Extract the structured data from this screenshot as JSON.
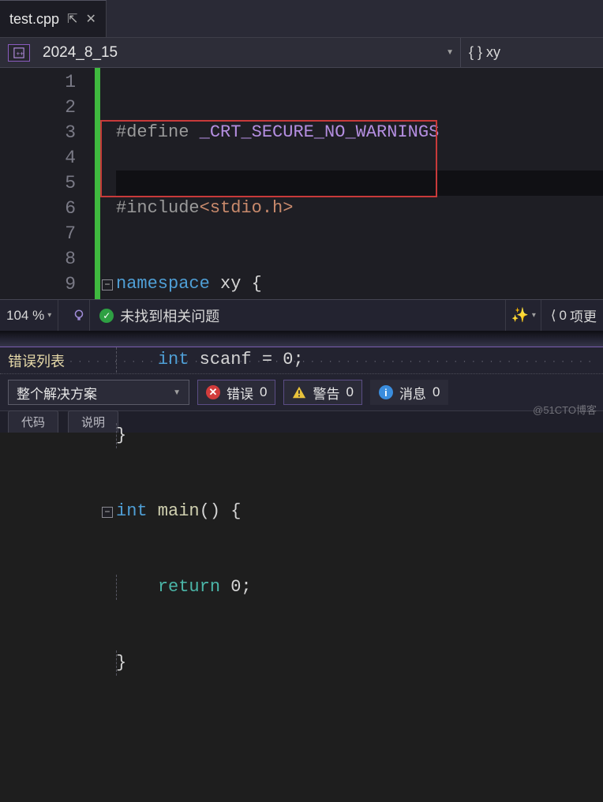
{
  "tab": {
    "filename": "test.cpp"
  },
  "dropdown": {
    "scope": "2024_8_15",
    "member": "{ } xy"
  },
  "code": {
    "lines": [
      "1",
      "2",
      "3",
      "4",
      "5",
      "6",
      "7",
      "8",
      "9"
    ],
    "l1_define": "#define",
    "l1_macro": " _CRT_SECURE_NO_WARNINGS",
    "l2_include": "#include",
    "l2_hdr": "<stdio.h>",
    "l3_ns": "namespace",
    "l3_name": " xy",
    "l3_brace": " {",
    "l4_int": "int",
    "l4_id": " scanf",
    "l4_rest": " = 0;",
    "l5_close": "}",
    "l6_int": "int",
    "l6_main": " main",
    "l6_paren": "() {",
    "l7_return": "return",
    "l7_zero": " 0;",
    "l8_close": "}"
  },
  "status": {
    "zoom": "104 %",
    "noissues": "未找到相关问题",
    "nav_num": "0",
    "nav_label": " 项更"
  },
  "errorlist": {
    "title": "错误列表",
    "scope": "整个解决方案",
    "errors_label": "错误",
    "errors_count": "0",
    "warnings_label": "警告",
    "warnings_count": "0",
    "info_label": "消息",
    "info_count": "0",
    "tab1": "代码",
    "tab2": "说明"
  },
  "watermark": "@51CTO博客"
}
